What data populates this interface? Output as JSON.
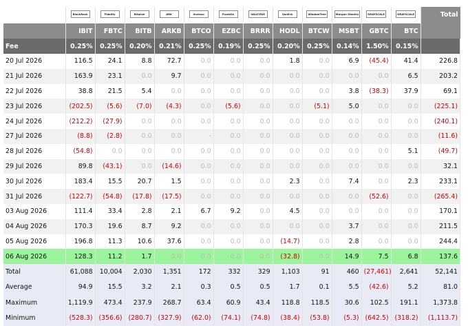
{
  "header": {
    "total_label": "Total",
    "fee_label": "Fee",
    "issuers": [
      "BlackRock",
      "Fidelity",
      "Bitwise",
      "ARK",
      "Invesco",
      "Franklin",
      "VALKYRIE",
      "VanEck",
      "WisdomTree",
      "Morgan Stanley",
      "GRAYSCALE",
      "GRAYSCALE"
    ],
    "tickers": [
      "IBIT",
      "FBTC",
      "BITB",
      "ARKB",
      "BTCO",
      "EZBC",
      "BRRR",
      "HODL",
      "BTCW",
      "MSBT",
      "GBTC",
      "BTC"
    ],
    "fees": [
      "0.25%",
      "0.25%",
      "0.20%",
      "0.21%",
      "0.25%",
      "0.19%",
      "0.25%",
      "0.20%",
      "0.25%",
      "0.14%",
      "1.50%",
      "0.15%"
    ]
  },
  "rows": [
    {
      "date": "20 Jul 2026",
      "values": [
        "116.5",
        "24.1",
        "8.8",
        "72.7",
        "0.0",
        "0.0",
        "0.0",
        "1.8",
        "0.0",
        "6.9",
        "(45.4)",
        "41.4"
      ],
      "total": "226.8"
    },
    {
      "date": "21 Jul 2026",
      "values": [
        "163.9",
        "23.1",
        "0.0",
        "9.7",
        "0.0",
        "0.0",
        "0.0",
        "0.0",
        "0.0",
        "0.0",
        "0.0",
        "6.5"
      ],
      "total": "203.2"
    },
    {
      "date": "22 Jul 2026",
      "values": [
        "38.8",
        "21.5",
        "5.4",
        "0.0",
        "0.0",
        "0.0",
        "0.0",
        "0.0",
        "0.0",
        "3.8",
        "(38.3)",
        "37.9"
      ],
      "total": "69.1"
    },
    {
      "date": "23 Jul 2026",
      "values": [
        "(202.5)",
        "(5.6)",
        "(7.0)",
        "(4.3)",
        "0.0",
        "(5.6)",
        "0.0",
        "0.0",
        "(5.1)",
        "5.0",
        "0.0",
        "0.0"
      ],
      "total": "(225.1)"
    },
    {
      "date": "24 Jul 2026",
      "values": [
        "(212.2)",
        "(27.9)",
        "0.0",
        "0.0",
        "0.0",
        "0.0",
        "0.0",
        "0.0",
        "0.0",
        "0.0",
        "0.0",
        "0.0"
      ],
      "total": "(240.1)"
    },
    {
      "date": "27 Jul 2026",
      "values": [
        "(8.8)",
        "(2.8)",
        "0.0",
        "0.0",
        "-",
        "0.0",
        "0.0",
        "0.0",
        "0.0",
        "0.0",
        "0.0",
        "0.0"
      ],
      "total": "(11.6)"
    },
    {
      "date": "28 Jul 2026",
      "values": [
        "(54.8)",
        "0.0",
        "0.0",
        "0.0",
        "0.0",
        "0.0",
        "0.0",
        "0.0",
        "0.0",
        "0.0",
        "0.0",
        "5.1"
      ],
      "total": "(49.7)"
    },
    {
      "date": "29 Jul 2026",
      "values": [
        "89.8",
        "(43.1)",
        "0.0",
        "(14.6)",
        "0.0",
        "0.0",
        "0.0",
        "0.0",
        "0.0",
        "0.0",
        "0.0",
        "0.0"
      ],
      "total": "32.1"
    },
    {
      "date": "30 Jul 2026",
      "values": [
        "183.4",
        "15.5",
        "20.7",
        "1.5",
        "0.0",
        "0.0",
        "0.0",
        "2.3",
        "0.0",
        "7.4",
        "0.0",
        "2.3"
      ],
      "total": "233.1"
    },
    {
      "date": "31 Jul 2026",
      "values": [
        "(122.7)",
        "(54.8)",
        "(17.8)",
        "(17.5)",
        "0.0",
        "0.0",
        "0.0",
        "0.0",
        "0.0",
        "0.0",
        "(52.6)",
        "0.0"
      ],
      "total": "(265.4)"
    },
    {
      "date": "03 Aug 2026",
      "values": [
        "111.4",
        "33.4",
        "2.8",
        "2.1",
        "6.7",
        "9.2",
        "0.0",
        "4.5",
        "0.0",
        "0.0",
        "0.0",
        "0.0"
      ],
      "total": "170.1"
    },
    {
      "date": "04 Aug 2026",
      "values": [
        "170.3",
        "19.6",
        "8.7",
        "9.2",
        "0.0",
        "0.0",
        "0.0",
        "0.0",
        "0.0",
        "3.7",
        "0.0",
        "0.0"
      ],
      "total": "211.5"
    },
    {
      "date": "05 Aug 2026",
      "values": [
        "196.8",
        "11.3",
        "10.6",
        "37.6",
        "0.0",
        "0.0",
        "0.0",
        "(14.7)",
        "0.0",
        "2.8",
        "0.0",
        "0.0"
      ],
      "total": "244.4"
    },
    {
      "date": "06 Aug 2026",
      "values": [
        "128.3",
        "11.2",
        "1.7",
        "0.0",
        "0.0",
        "0.0",
        "0.0",
        "(32.8)",
        "0.0",
        "14.9",
        "7.5",
        "6.8"
      ],
      "total": "137.6",
      "highlight": true
    }
  ],
  "stats": [
    {
      "label": "Total",
      "values": [
        "61,088",
        "10,004",
        "2,030",
        "1,351",
        "172",
        "332",
        "329",
        "1,103",
        "91",
        "460",
        "(27,461)",
        "2,641"
      ],
      "total": "52,141"
    },
    {
      "label": "Average",
      "values": [
        "94.9",
        "15.5",
        "3.2",
        "2.1",
        "0.3",
        "0.5",
        "0.5",
        "1.7",
        "0.1",
        "5.5",
        "(42.6)",
        "5.2"
      ],
      "total": "81.0"
    },
    {
      "label": "Maximum",
      "values": [
        "1,119.9",
        "473.4",
        "237.9",
        "268.7",
        "63.4",
        "60.9",
        "43.4",
        "118.8",
        "118.5",
        "30.6",
        "102.5",
        "191.1"
      ],
      "total": "1,373.8"
    },
    {
      "label": "Minimum",
      "values": [
        "(528.3)",
        "(356.6)",
        "(280.7)",
        "(327.9)",
        "(62.0)",
        "(74.1)",
        "(74.8)",
        "(38.4)",
        "(53.8)",
        "(5.3)",
        "(642.5)",
        "(318.2)"
      ],
      "total": "(1,113.7)"
    }
  ],
  "colors": {
    "negative": "#cc0000",
    "zero": "#bbbbbb",
    "header_bg": "#8c8c8c",
    "fee_bg": "#6b6b6b",
    "highlight_row": "#9cf59c",
    "stats_bg": "#e8ebf5"
  }
}
